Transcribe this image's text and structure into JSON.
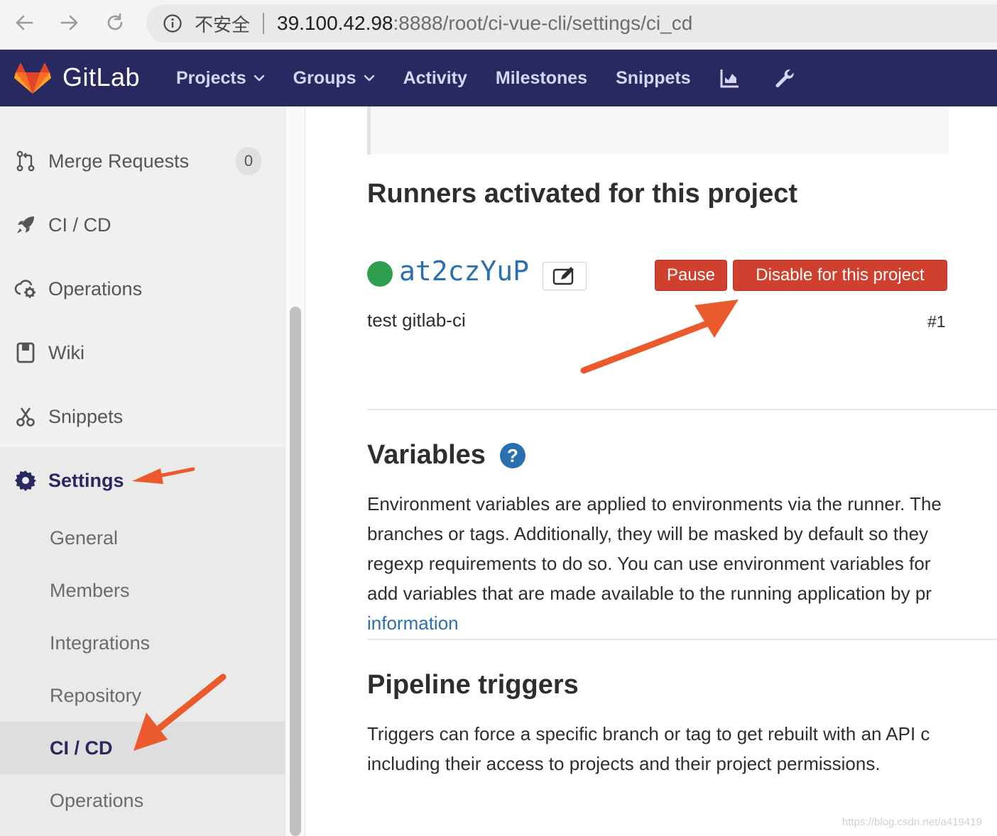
{
  "browser": {
    "security_label": "不安全",
    "url_host": "39.100.42.98",
    "url_path": ":8888/root/ci-vue-cli/settings/ci_cd"
  },
  "header": {
    "brand": "GitLab",
    "nav": {
      "projects": "Projects",
      "groups": "Groups",
      "activity": "Activity",
      "milestones": "Milestones",
      "snippets": "Snippets"
    },
    "icons": [
      "chart-icon",
      "wrench-icon"
    ],
    "background_color": "#292961"
  },
  "sidebar": {
    "items": [
      {
        "label": "Merge Requests",
        "count": "0",
        "icon": "merge-request-icon"
      },
      {
        "label": "CI / CD",
        "icon": "rocket-icon"
      },
      {
        "label": "Operations",
        "icon": "cloud-gear-icon"
      },
      {
        "label": "Wiki",
        "icon": "book-icon"
      },
      {
        "label": "Snippets",
        "icon": "scissors-icon"
      },
      {
        "label": "Settings",
        "icon": "gear-icon"
      }
    ],
    "settings_sub": [
      {
        "label": "General"
      },
      {
        "label": "Members"
      },
      {
        "label": "Integrations"
      },
      {
        "label": "Repository"
      },
      {
        "label": "CI / CD",
        "active": true
      },
      {
        "label": "Operations"
      }
    ]
  },
  "main": {
    "runners_heading": "Runners activated for this project",
    "runner": {
      "token": "at2czYuP",
      "status_color": "#2f9e4f",
      "description": "test gitlab-ci",
      "id": "#1",
      "pause_label": "Pause",
      "disable_label": "Disable for this project"
    },
    "variables_heading": "Variables",
    "variables_text": [
      "Environment variables are applied to environments via the runner. The",
      "branches or tags. Additionally, they will be masked by default so they",
      "regexp requirements to do so. You can use environment variables for",
      "add variables that are made available to the running application by pr"
    ],
    "variables_link": "information",
    "triggers_heading": "Pipeline triggers",
    "triggers_text": [
      "Triggers can force a specific branch or tag to get rebuilt with an API c",
      "including their access to projects and their project permissions."
    ]
  },
  "watermark": "https://blog.csdn.net/a419419",
  "annotation_color": "#ea5a2c"
}
